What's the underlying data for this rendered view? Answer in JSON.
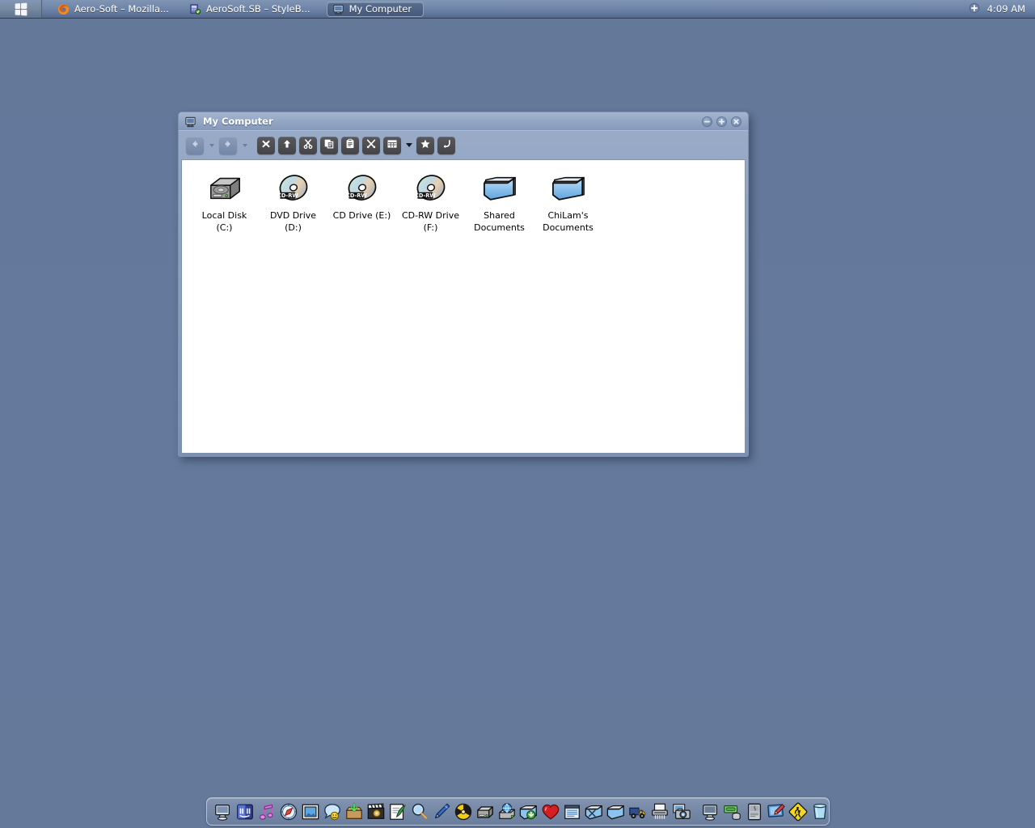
{
  "desktop": {
    "background_color": "#64799b"
  },
  "taskbar": {
    "start_button": {
      "name": "start-button",
      "icon": "windows-flag-icon",
      "label": ""
    },
    "tasks": [
      {
        "icon": "firefox-icon",
        "label": "Aero-Soft – Mozilla...",
        "active": false
      },
      {
        "icon": "styleb-icon",
        "label": "AeroSoft.SB – StyleB...",
        "active": false
      },
      {
        "icon": "my-computer-icon",
        "label": "My Computer",
        "active": true
      }
    ],
    "tray": {
      "indicator_icon": "circle-plus-icon",
      "clock": "4:09 AM"
    }
  },
  "window": {
    "title": "My Computer",
    "title_icon": "my-computer-icon",
    "controls": [
      {
        "name": "minimize-button",
        "glyph": "minus"
      },
      {
        "name": "maximize-button",
        "glyph": "plus"
      },
      {
        "name": "close-button",
        "glyph": "close"
      }
    ],
    "toolbar": [
      {
        "name": "back-button",
        "icon": "arrow-left-icon",
        "style": "light",
        "enabled": false,
        "dropdown": true
      },
      {
        "name": "forward-button",
        "icon": "arrow-right-icon",
        "style": "light",
        "enabled": false,
        "dropdown": true
      },
      {
        "name": "stop-button",
        "icon": "stop-x-icon",
        "style": "dark",
        "enabled": true,
        "dropdown": false
      },
      {
        "name": "up-button",
        "icon": "arrow-up-icon",
        "style": "dark",
        "enabled": true,
        "dropdown": false
      },
      {
        "name": "cut-button",
        "icon": "scissors-icon",
        "style": "dark",
        "enabled": true,
        "dropdown": false
      },
      {
        "name": "copy-button",
        "icon": "copy-icon",
        "style": "dark",
        "enabled": true,
        "dropdown": false
      },
      {
        "name": "paste-button",
        "icon": "paste-icon",
        "style": "dark",
        "enabled": true,
        "dropdown": false
      },
      {
        "name": "tools-button",
        "icon": "crossed-tools-icon",
        "style": "dark",
        "enabled": true,
        "dropdown": false
      },
      {
        "name": "views-button",
        "icon": "views-grid-icon",
        "style": "dark",
        "enabled": true,
        "dropdown": true
      },
      {
        "name": "favorites-button",
        "icon": "star-icon",
        "style": "dark",
        "enabled": true,
        "dropdown": false
      },
      {
        "name": "undo-button",
        "icon": "undo-arrow-icon",
        "style": "dark",
        "enabled": true,
        "dropdown": false
      }
    ],
    "items": [
      {
        "icon": "hard-disk-icon",
        "line1": "Local Disk",
        "line2": "(C:)"
      },
      {
        "icon": "cd-rw-disc-icon",
        "line1": "DVD Drive",
        "line2": "(D:)"
      },
      {
        "icon": "cd-rw-disc-icon",
        "line1": "CD Drive (E:)",
        "line2": ""
      },
      {
        "icon": "cd-rw-disc-icon",
        "line1": "CD-RW Drive",
        "line2": "(F:)"
      },
      {
        "icon": "folder-icon",
        "line1": "Shared",
        "line2": "Documents"
      },
      {
        "icon": "folder-icon",
        "line1": "ChiLam's",
        "line2": "Documents"
      }
    ]
  },
  "dock": {
    "items": [
      {
        "name": "display-icon"
      },
      {
        "name": "finder-icon"
      },
      {
        "name": "music-note-icon"
      },
      {
        "name": "safari-compass-icon"
      },
      {
        "name": "photo-frame-icon"
      },
      {
        "name": "chat-bubble-icon"
      },
      {
        "name": "download-box-icon"
      },
      {
        "name": "movie-clapper-icon"
      },
      {
        "name": "textedit-quill-icon"
      },
      {
        "name": "magnifier-icon"
      },
      {
        "name": "pen-icon"
      },
      {
        "name": "burn-disc-icon"
      },
      {
        "name": "hard-drive-icon"
      },
      {
        "name": "network-globe-icon"
      },
      {
        "name": "download-folder-icon"
      },
      {
        "name": "heart-icon"
      },
      {
        "name": "notes-icon"
      },
      {
        "name": "utilities-folder-icon"
      },
      {
        "name": "folder-blue-icon"
      },
      {
        "name": "truck-icon"
      },
      {
        "name": "shredder-icon"
      },
      {
        "name": "camera-icon"
      },
      {
        "name": "monitor-icon"
      },
      {
        "name": "money-icon"
      },
      {
        "name": "mac-tower-icon"
      },
      {
        "name": "paint-icon"
      },
      {
        "name": "warning-sign-icon"
      },
      {
        "name": "trash-icon"
      }
    ]
  }
}
